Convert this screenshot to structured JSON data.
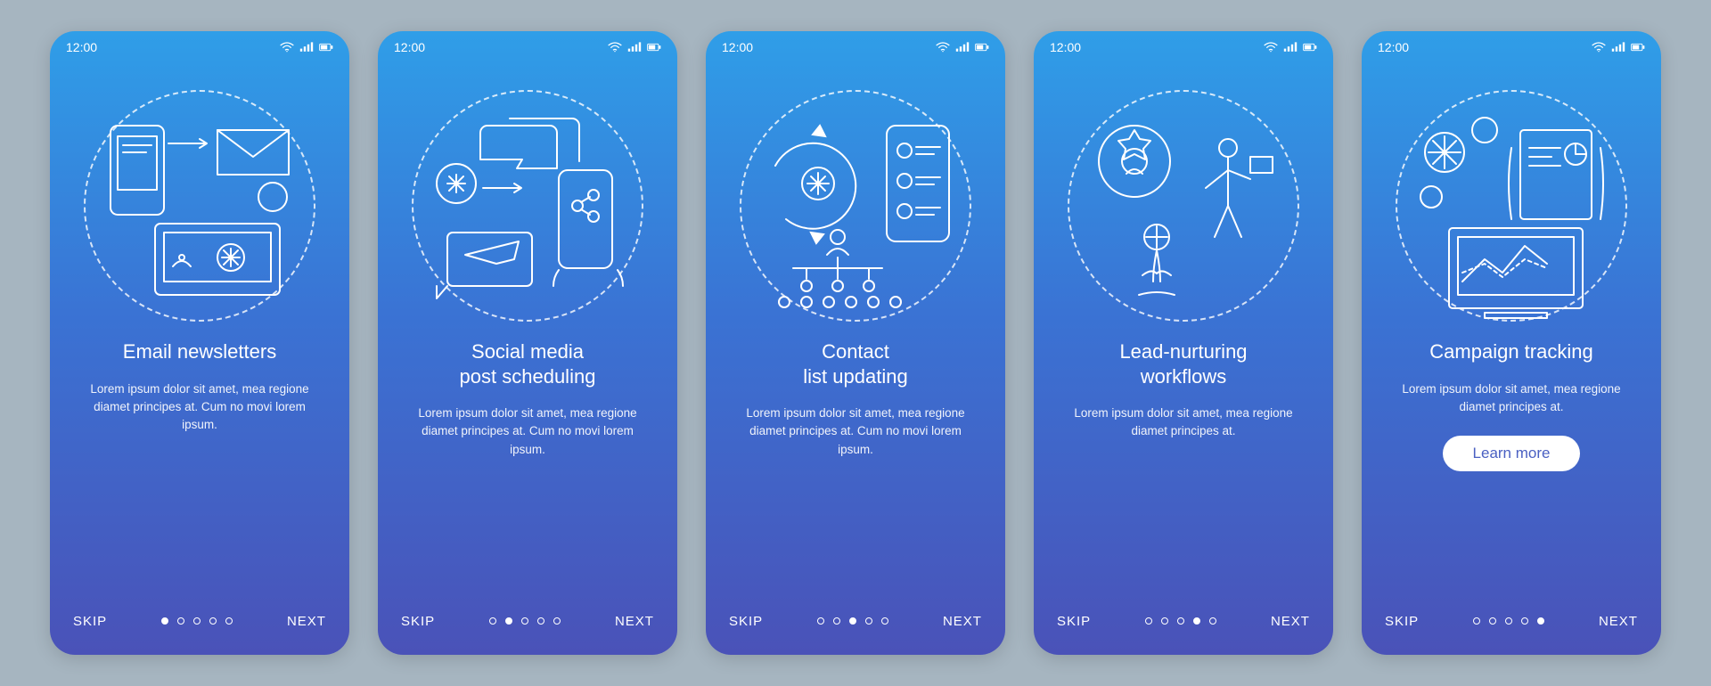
{
  "status": {
    "time": "12:00"
  },
  "nav": {
    "skip": "SKIP",
    "next": "NEXT"
  },
  "cta": {
    "learn_more": "Learn more"
  },
  "screens": [
    {
      "illustration": "email-newsletters-icon",
      "title": "Email newsletters",
      "body": "Lorem ipsum dolor sit amet, mea regione diamet principes at. Cum no movi lorem ipsum.",
      "active_dot": 0,
      "show_cta": false
    },
    {
      "illustration": "social-media-scheduling-icon",
      "title": "Social media\npost scheduling",
      "body": "Lorem ipsum dolor sit amet, mea regione diamet principes at. Cum no movi lorem ipsum.",
      "active_dot": 1,
      "show_cta": false
    },
    {
      "illustration": "contact-list-updating-icon",
      "title": "Contact\nlist updating",
      "body": "Lorem ipsum dolor sit amet, mea regione diamet principes at. Cum no movi lorem ipsum.",
      "active_dot": 2,
      "show_cta": false
    },
    {
      "illustration": "lead-nurturing-workflows-icon",
      "title": "Lead-nurturing\nworkflows",
      "body": "Lorem ipsum dolor sit amet, mea regione diamet principes at.",
      "active_dot": 3,
      "show_cta": false
    },
    {
      "illustration": "campaign-tracking-icon",
      "title": "Campaign tracking",
      "body": "Lorem ipsum dolor sit amet, mea regione diamet principes at.",
      "active_dot": 4,
      "show_cta": true
    }
  ],
  "dot_count": 5
}
